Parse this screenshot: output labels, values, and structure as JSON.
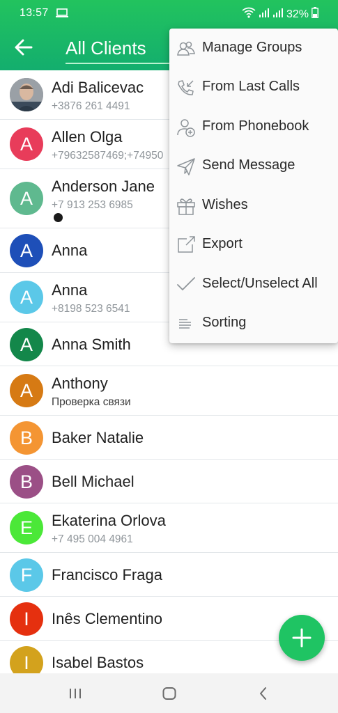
{
  "status_bar": {
    "time": "13:57",
    "battery": "32%",
    "icons": [
      "laptop-icon",
      "wifi-icon",
      "signal-icon",
      "signal-icon",
      "battery-icon"
    ]
  },
  "app_bar": {
    "title": "All Clients",
    "back_icon": "arrow-left-icon"
  },
  "contacts": [
    {
      "initial": "",
      "name": "Adi Balicevac",
      "sub": "+3876 261 4491",
      "color": "#8a9096",
      "photo": true
    },
    {
      "initial": "A",
      "name": "Allen Olga",
      "sub": "+79632587469;+74950",
      "color": "#e83c5a"
    },
    {
      "initial": "A",
      "name": "Anderson Jane",
      "sub": "+7 913 253 6985",
      "color": "#5fb98f",
      "dot": true
    },
    {
      "initial": "A",
      "name": "Anna",
      "sub": "",
      "color": "#1e4fb8"
    },
    {
      "initial": "A",
      "name": "Anna",
      "sub": "+8198 523 6541",
      "color": "#5bc8e8"
    },
    {
      "initial": "A",
      "name": "Anna Smith",
      "sub": "",
      "color": "#13874a"
    },
    {
      "initial": "A",
      "name": "Anthony",
      "sub": "Проверка связи",
      "color": "#d67a14"
    },
    {
      "initial": "B",
      "name": "Baker Natalie",
      "sub": "",
      "color": "#f49533"
    },
    {
      "initial": "B",
      "name": "Bell Michael",
      "sub": "",
      "color": "#9b4f86"
    },
    {
      "initial": "E",
      "name": "Ekaterina Orlova",
      "sub": "+7 495 004 4961",
      "color": "#4be838"
    },
    {
      "initial": "F",
      "name": "Francisco Fraga",
      "sub": "",
      "color": "#5bc8e8"
    },
    {
      "initial": "I",
      "name": "Inês Clementino",
      "sub": "",
      "color": "#e5300f"
    },
    {
      "initial": "I",
      "name": "Isabel Bastos",
      "sub": "",
      "color": "#d3a21d"
    }
  ],
  "menu": [
    {
      "label": "Manage Groups",
      "icon": "groups-icon"
    },
    {
      "label": "From Last Calls",
      "icon": "call-received-icon"
    },
    {
      "label": "From Phonebook",
      "icon": "add-person-icon"
    },
    {
      "label": "Send Message",
      "icon": "send-icon"
    },
    {
      "label": "Wishes",
      "icon": "gift-icon"
    },
    {
      "label": "Export",
      "icon": "export-icon"
    },
    {
      "label": "Select/Unselect All",
      "icon": "check-icon"
    },
    {
      "label": "Sorting",
      "icon": "sort-icon"
    }
  ],
  "fab": {
    "icon": "plus-icon"
  },
  "nav_bar": {
    "icons": [
      "recents-icon",
      "home-icon",
      "back-icon"
    ]
  },
  "colors": {
    "accent": "#1fc463",
    "appbar": "#22c35e"
  }
}
